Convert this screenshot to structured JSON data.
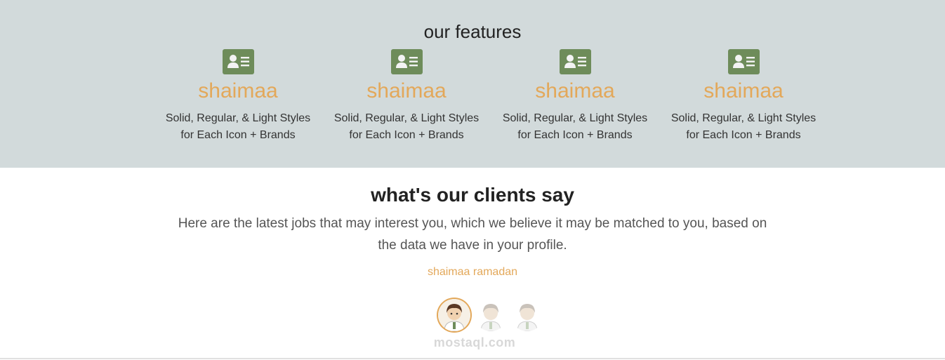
{
  "features": {
    "title": "our features",
    "items": [
      {
        "name": "shaimaa",
        "desc_line1": "Solid, Regular, & Light Styles",
        "desc_line2": "for Each Icon + Brands",
        "icon": "id-card-icon"
      },
      {
        "name": "shaimaa",
        "desc_line1": "Solid, Regular, & Light Styles",
        "desc_line2": "for Each Icon + Brands",
        "icon": "id-card-icon"
      },
      {
        "name": "shaimaa",
        "desc_line1": "Solid, Regular, & Light Styles",
        "desc_line2": "for Each Icon + Brands",
        "icon": "id-card-icon"
      },
      {
        "name": "shaimaa",
        "desc_line1": "Solid, Regular, & Light Styles",
        "desc_line2": "for Each Icon + Brands",
        "icon": "id-card-icon"
      }
    ]
  },
  "clients": {
    "title": "what's our clients say",
    "text": "Here are the latest jobs that may interest you, which we believe it may be matched to you, based on the data we have in your profile.",
    "name": "shaimaa ramadan",
    "avatars": [
      "avatar-active",
      "avatar",
      "avatar"
    ]
  },
  "watermark": "mostaql.com",
  "colors": {
    "features_bg": "#d2dadb",
    "accent": "#e3a85a",
    "icon_bg": "#6e8c5a"
  }
}
